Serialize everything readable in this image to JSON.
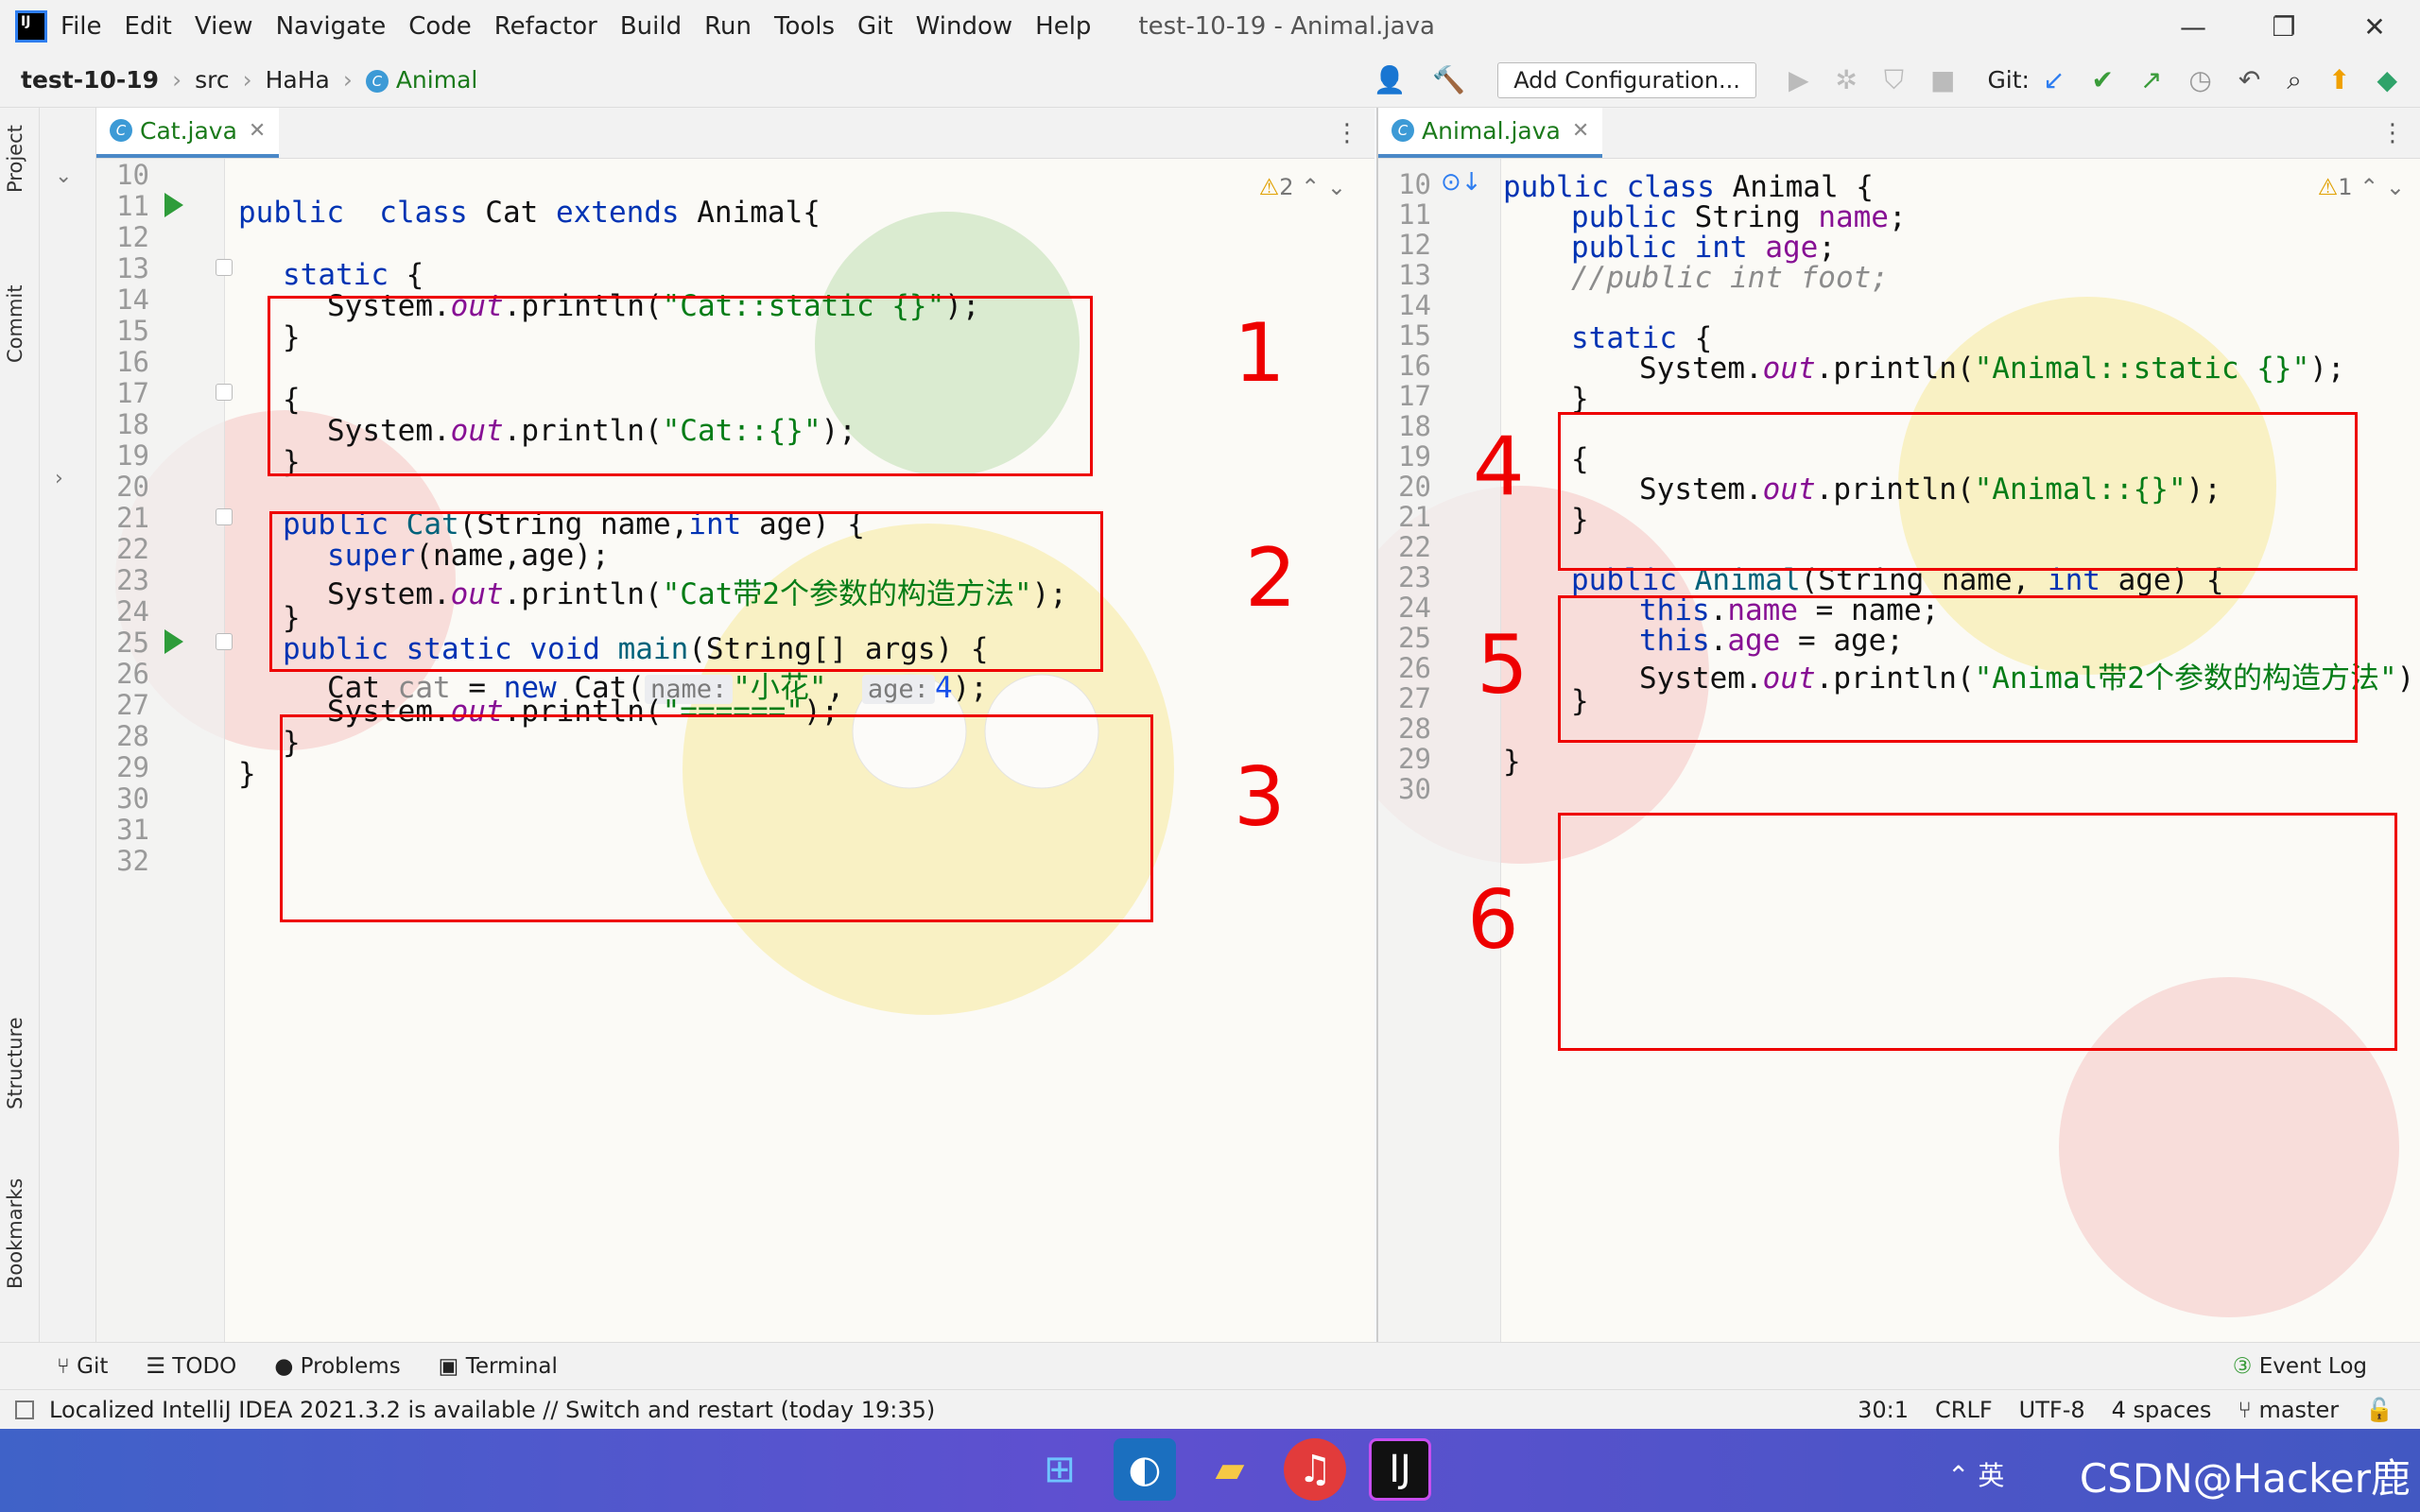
{
  "window": {
    "title": "test-10-19 - Animal.java",
    "minimize": "—",
    "restore": "❐",
    "close": "✕"
  },
  "menu": [
    "File",
    "Edit",
    "View",
    "Navigate",
    "Code",
    "Refactor",
    "Build",
    "Run",
    "Tools",
    "Git",
    "Window",
    "Help"
  ],
  "breadcrumb": {
    "project": "test-10-19",
    "src": "src",
    "pkg": "HaHa",
    "cls": "Animal"
  },
  "toolbar": {
    "add_config": "Add Configuration...",
    "git_label": "Git:"
  },
  "sidebar": {
    "project": "Project",
    "commit": "Commit",
    "structure": "Structure",
    "bookmarks": "Bookmarks"
  },
  "left_editor": {
    "tab": "Cat.java",
    "warnings": "2",
    "lines": [
      "10",
      "11",
      "12",
      "13",
      "14",
      "15",
      "16",
      "17",
      "18",
      "19",
      "20",
      "21",
      "22",
      "23",
      "24",
      "25",
      "26",
      "27",
      "28",
      "29",
      "30",
      "31",
      "32"
    ],
    "code": {
      "l11a": "public",
      "l11b": "  class ",
      "l11c": "Cat ",
      "l11d": "extends ",
      "l11e": "Animal{",
      "l13": "static",
      "l14a": "System.",
      "l14b": "out",
      "l14c": ".println(",
      "l14d": "\"Cat::static {}\"",
      "l14e": ");",
      "l18a": "System.",
      "l18b": "out",
      "l18c": ".println(",
      "l18d": "\"Cat::{}\"",
      "l18e": ");",
      "l21a": "public ",
      "l21b": "Cat",
      "l21c": "(String name,",
      "l21d": "int",
      " l21e": "",
      "l21f": " age) {",
      "l22a": "super",
      "l22b": "(name,age);",
      "l23a": "System.",
      "l23b": "out",
      "l23c": ".println(",
      "l23d": "\"Cat带2个参数的构造方法\"",
      "l23e": ");",
      "l25a": "public static void ",
      "l25b": "main",
      "l25c": "(String[] args) {",
      "l26a": "Cat ",
      "l26b": "cat",
      " l26c": "",
      "l26d": " = ",
      "l26e": "new ",
      "l26f": "Cat(",
      "l26h1": "name:",
      "l26s": "\"小花\"",
      "l26g": ", ",
      "l26h2": "age:",
      "l26n": "4",
      "l26i": ");",
      "l27a": "System.",
      "l27b": "out",
      "l27c": ".println(",
      "l27d": "\"======\"",
      "l27e": ");"
    },
    "annotations": [
      "1",
      "2",
      "3"
    ]
  },
  "right_editor": {
    "tab": "Animal.java",
    "warnings": "1",
    "lines": [
      "10",
      "11",
      "12",
      "13",
      "14",
      "15",
      "16",
      "17",
      "18",
      "19",
      "20",
      "21",
      "22",
      "23",
      "24",
      "25",
      "26",
      "27",
      "28",
      "29",
      "30"
    ],
    "code": {
      "l10a": "public class ",
      "l10b": "Animal {",
      "l11a": "public ",
      "l11b": "String ",
      "l11c": "name",
      "l12a": "public int ",
      "l12b": "age",
      "l13": "//public int foot;",
      "l15": "static",
      "l16a": "System.",
      "l16b": "out",
      "l16c": ".println(",
      "l16d": "\"Animal::static {}\"",
      "l16e": ");",
      "l20a": "System.",
      "l20b": "out",
      "l20c": ".println(",
      "l20d": "\"Animal::{}\"",
      "l20e": ");",
      "l23a": "public ",
      "l23b": "Animal",
      "l23c": "(String name, ",
      "l23d": "int",
      "l23e": " age) {",
      "l24a": "this",
      "l24b": ".",
      "l24c": "name",
      "l24d": " = name;",
      "l25a": "this",
      "l25b": ".",
      "l25c": "age",
      "l25d": " = age;",
      "l26a": "System.",
      "l26b": "out",
      "l26c": ".println(",
      "l26d": "\"Animal带2个参数的构造方法\"",
      "l26e": ");"
    },
    "annotations": [
      "4",
      "5",
      "6"
    ]
  },
  "tool_windows": {
    "git": "Git",
    "todo": "TODO",
    "problems": "Problems",
    "terminal": "Terminal",
    "event_log": "Event Log"
  },
  "status": {
    "message": "Localized IntelliJ IDEA 2021.3.2 is available // Switch and restart (today 19:35)",
    "pos": "30:1",
    "eol": "CRLF",
    "enc": "UTF-8",
    "indent": "4 spaces",
    "branch": "master"
  },
  "taskbar": {
    "ime": "英",
    "watermark": "CSDN@Hacker鹿"
  }
}
